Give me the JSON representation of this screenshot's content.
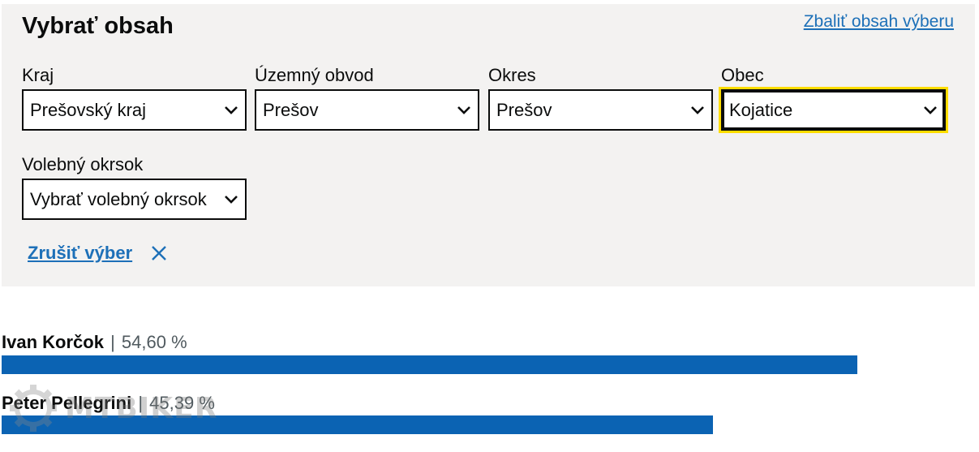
{
  "panel": {
    "title": "Vybrať obsah",
    "collapse_link": "Zbaliť obsah výberu",
    "filters": [
      {
        "label": "Kraj",
        "value": "Prešovský kraj"
      },
      {
        "label": "Územný obvod",
        "value": "Prešov"
      },
      {
        "label": "Okres",
        "value": "Prešov"
      },
      {
        "label": "Obec",
        "value": "Kojatice",
        "focused": true
      }
    ],
    "district": {
      "label": "Volebný okrsok",
      "value": "Vybrať volebný okrsok"
    },
    "clear_label": "Zrušiť výber"
  },
  "results": [
    {
      "name": "Ivan Korčok",
      "separator": "|",
      "percent_text": "54,60 %",
      "percent": 54.6
    },
    {
      "name": "Peter Pellegrini",
      "separator": "|",
      "percent_text": "45,39 %",
      "percent": 45.39
    }
  ],
  "watermark": {
    "text": "MTBIKER"
  },
  "colors": {
    "link": "#1d70b8",
    "bar": "#0b63b3",
    "focus": "#ffdd00",
    "panel_bg": "#f3f2f1"
  }
}
